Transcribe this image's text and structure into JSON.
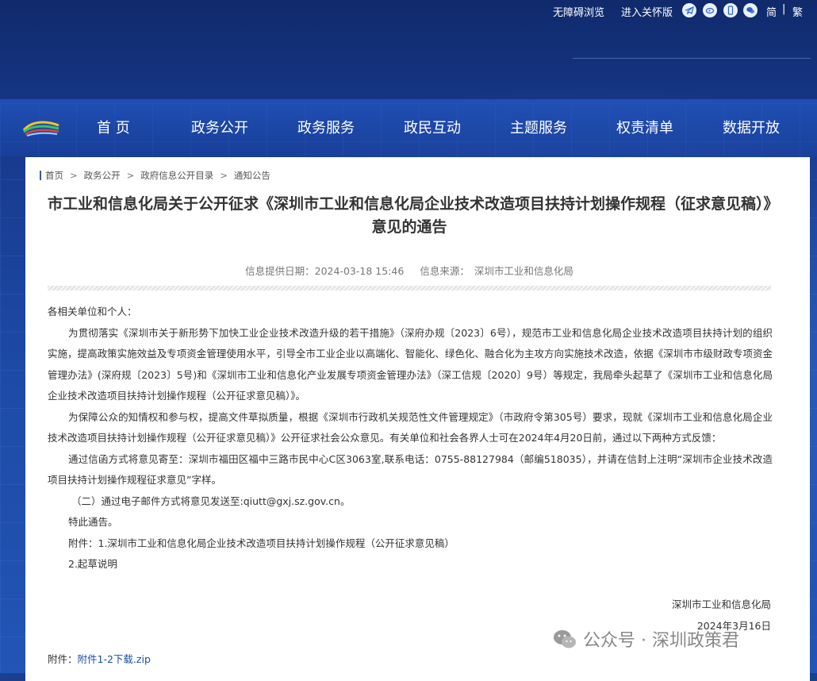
{
  "topbar": {
    "accessibility": "无障碍浏览",
    "care_version": "进入关怀版",
    "simplified": "简",
    "separator": "|",
    "traditional": "繁"
  },
  "nav": {
    "items": [
      "首 页",
      "政务公开",
      "政务服务",
      "政民互动",
      "主题服务",
      "权责清单",
      "数据开放"
    ]
  },
  "breadcrumb": [
    "首页",
    "政务公开",
    "政府信息公开目录",
    "通知公告"
  ],
  "breadcrumb_sep": ">",
  "article": {
    "title": "市工业和信息化局关于公开征求《深圳市工业和信息化局企业技术改造项目扶持计划操作规程（征求意见稿）》意见的通告",
    "date_label": "信息提供日期：2024-03-18 15:46",
    "source_label": "信息来源：",
    "source": "深圳市工业和信息化局",
    "greeting": "各相关单位和个人：",
    "p1": "为贯彻落实《深圳市关于新形势下加快工业企业技术改造升级的若干措施》（深府办规〔2023〕6号），规范市工业和信息化局企业技术改造项目扶持计划的组织实施，提高政策实施效益及专项资金管理使用水平，引导全市工业企业以高端化、智能化、绿色化、融合化为主攻方向实施技术改造，依据《深圳市市级财政专项资金管理办法》(深府规〔2023〕5号)和《深圳市工业和信息化产业发展专项资金管理办法》（深工信规〔2020〕9号）等规定，我局牵头起草了《深圳市工业和信息化局企业技术改造项目扶持计划操作规程（公开征求意见稿）》。",
    "p2": "为保障公众的知情权和参与权，提高文件草拟质量，根据《深圳市行政机关规范性文件管理规定》（市政府令第305号）要求，现就《深圳市工业和信息化局企业技术改造项目扶持计划操作规程（公开征求意见稿）》公开征求社会公众意见。有关单位和社会各界人士可在2024年4月20日前，通过以下两种方式反馈：",
    "p3": "通过信函方式将意见寄至：深圳市福田区福中三路市民中心C区3063室,联系电话：0755-88127984（邮编518035），并请在信封上注明“深圳市企业技术改造项目扶持计划操作规程征求意见”字样。",
    "p4": "（二）通过电子邮件方式将意见发送至:qiutt@gxj.sz.gov.cn。",
    "p5": "特此通告。",
    "p6": "附件：1.深圳市工业和信息化局企业技术改造项目扶持计划操作规程（公开征求意见稿）",
    "p7": "2.起草说明",
    "signer": "深圳市工业和信息化局",
    "sign_date": "2024年3月16日",
    "attachment_label": "附件：",
    "attachment_link": "附件1-2下载.zip"
  },
  "watermark": "公众号 · 深圳政策君"
}
